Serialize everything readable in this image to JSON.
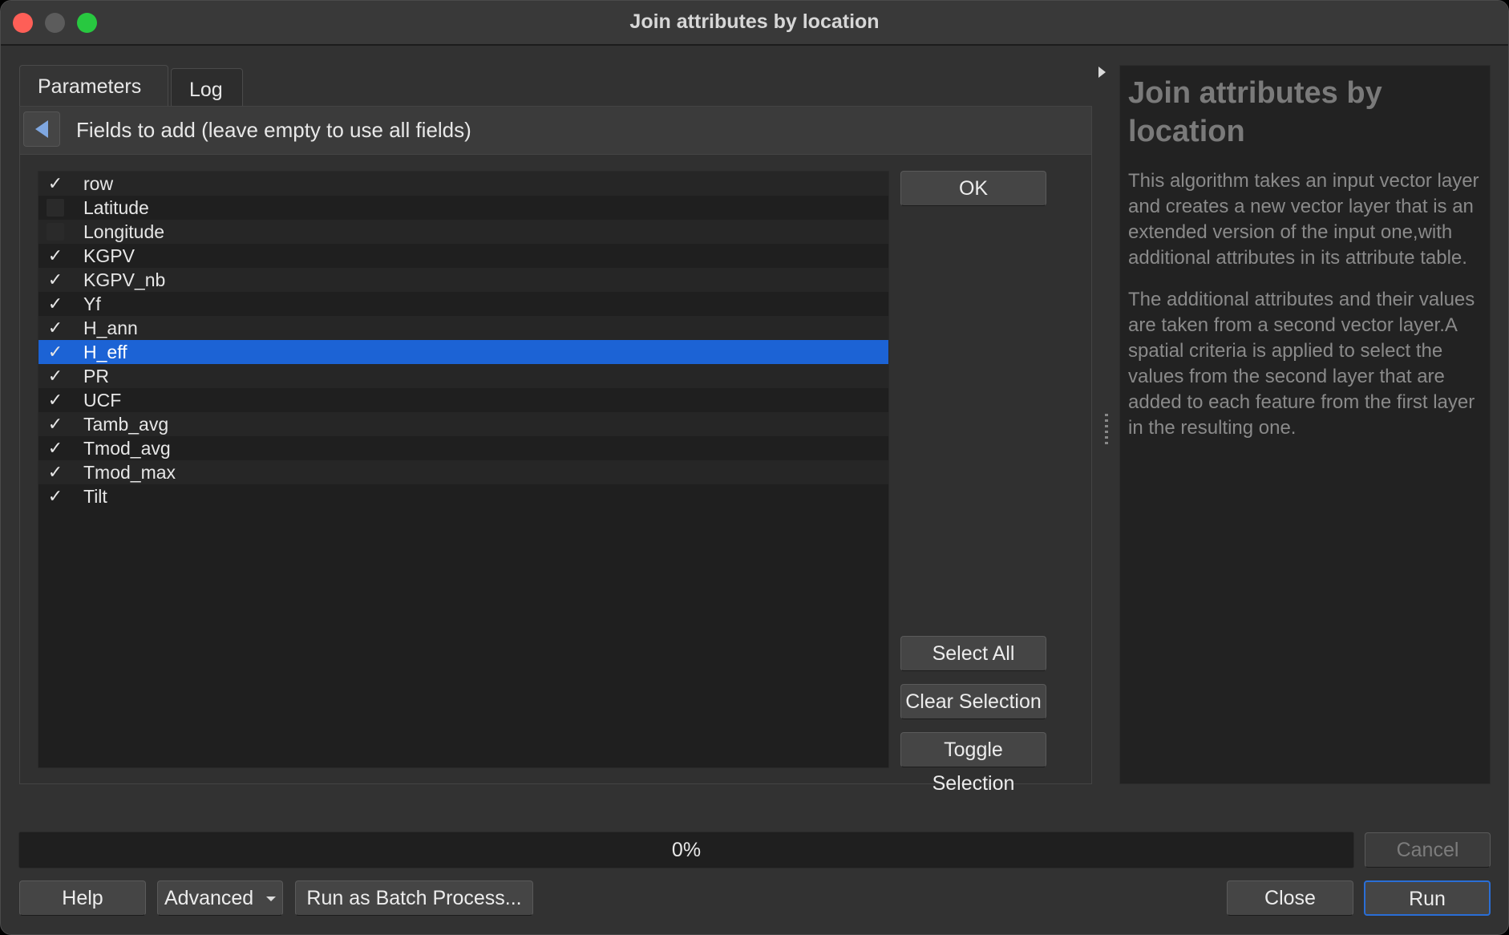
{
  "window": {
    "title": "Join attributes by location"
  },
  "tabs": [
    {
      "label": "Parameters"
    },
    {
      "label": "Log"
    }
  ],
  "panel": {
    "header": "Fields to add (leave empty to use all fields)"
  },
  "fields": [
    {
      "name": "row",
      "checked": true
    },
    {
      "name": "Latitude",
      "checked": false
    },
    {
      "name": "Longitude",
      "checked": false
    },
    {
      "name": "KGPV",
      "checked": true
    },
    {
      "name": "KGPV_nb",
      "checked": true
    },
    {
      "name": "Yf",
      "checked": true
    },
    {
      "name": "H_ann",
      "checked": true
    },
    {
      "name": "H_eff",
      "checked": true,
      "selected": true
    },
    {
      "name": "PR",
      "checked": true
    },
    {
      "name": "UCF",
      "checked": true
    },
    {
      "name": "Tamb_avg",
      "checked": true
    },
    {
      "name": "Tmod_avg",
      "checked": true
    },
    {
      "name": "Tmod_max",
      "checked": true
    },
    {
      "name": "Tilt",
      "checked": true
    }
  ],
  "side_buttons": {
    "ok": "OK",
    "select_all": "Select All",
    "clear_selection": "Clear Selection",
    "toggle_selection": "Toggle Selection"
  },
  "help": {
    "title": "Join attributes by location",
    "paragraph1": "This algorithm takes an input vector layer and creates a new vector layer that is an extended version of the input one,with additional attributes in its attribute table.",
    "paragraph2": "The additional attributes and their values are taken from a second vector layer.A spatial criteria is applied to select the values from the second layer that are added to each feature from the first layer in the resulting one."
  },
  "progress": {
    "label": "0%",
    "value": 0
  },
  "footer": {
    "help": "Help",
    "advanced": "Advanced",
    "batch": "Run as Batch Process...",
    "cancel": "Cancel",
    "close": "Close",
    "run": "Run"
  }
}
